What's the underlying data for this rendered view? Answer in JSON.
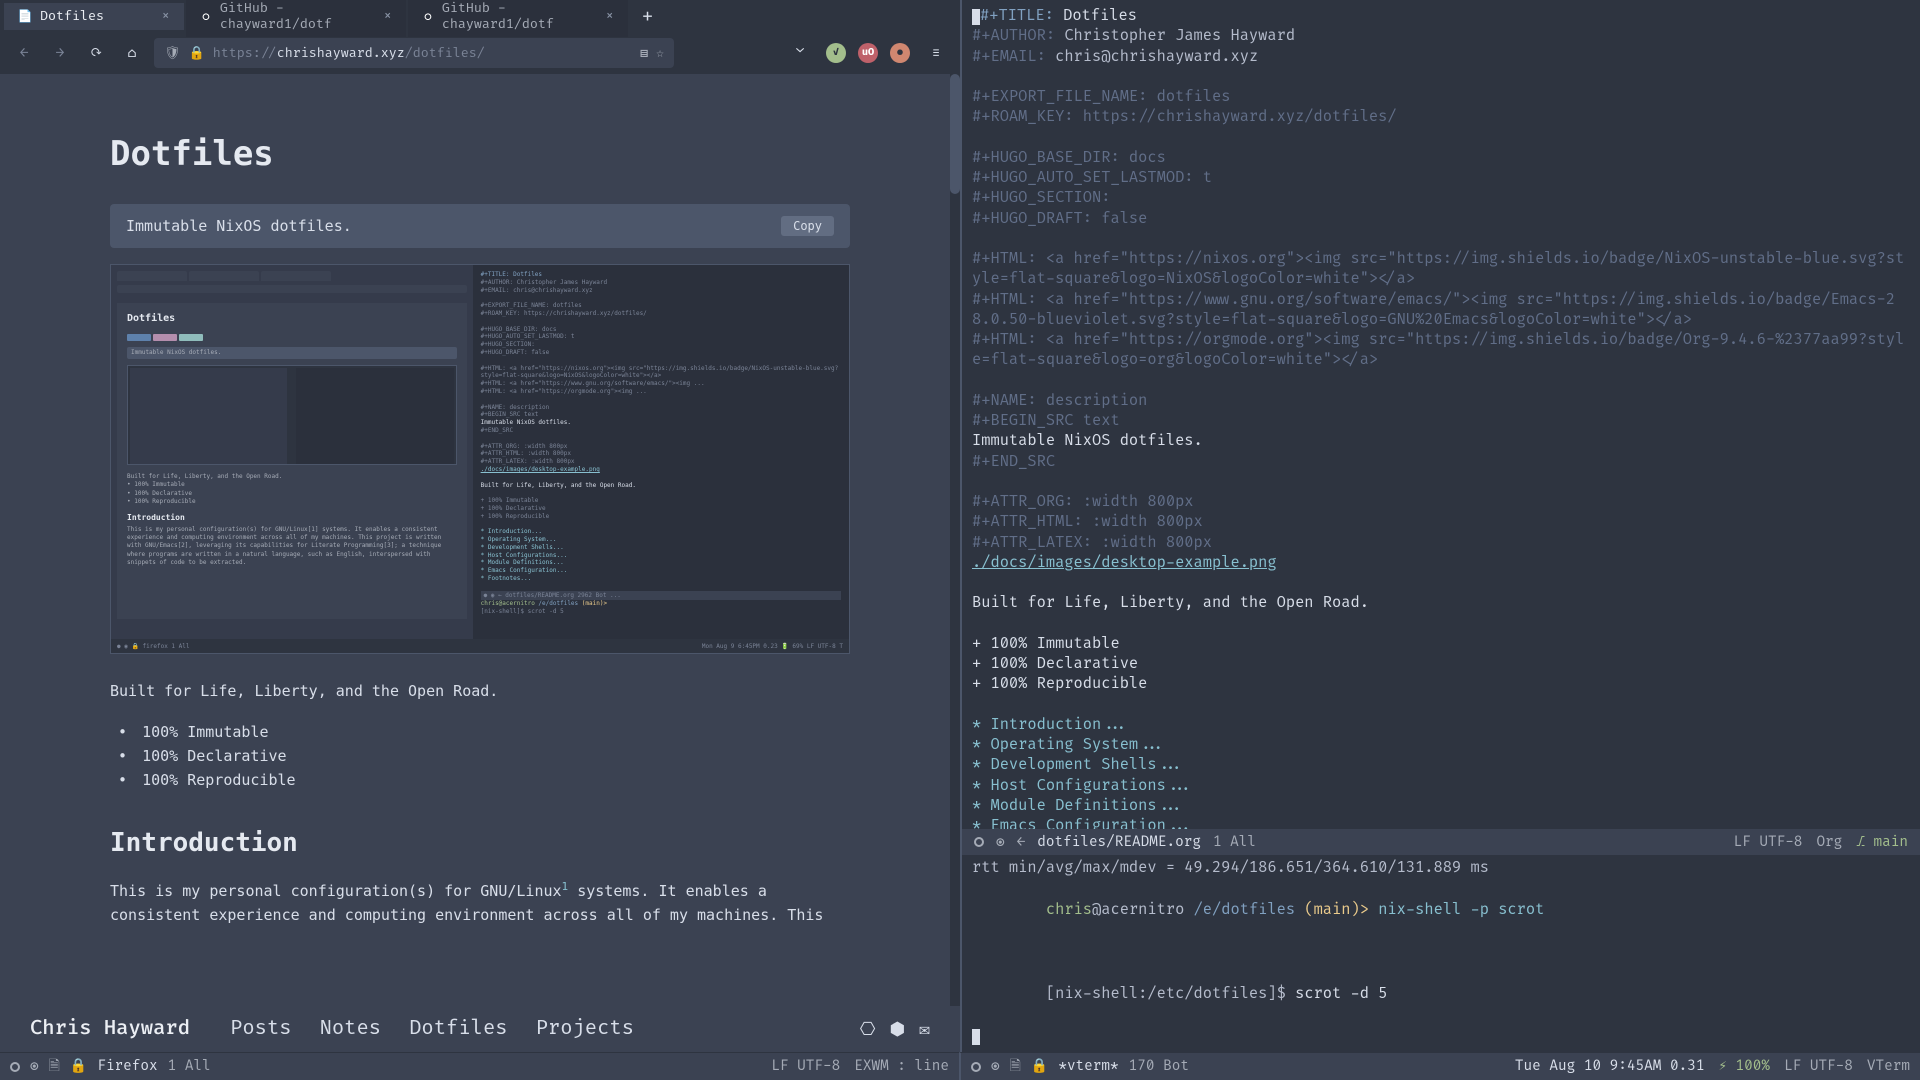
{
  "browser": {
    "tabs": [
      {
        "label": "Dotfiles",
        "icon": "📄"
      },
      {
        "label": "GitHub - chayward1/dotf",
        "icon": "◐"
      },
      {
        "label": "GitHub - chayward1/dotf",
        "icon": "◐"
      }
    ],
    "url_protocol": "https://",
    "url_domain": "chrishayward.xyz",
    "url_path": "/dotfiles/"
  },
  "page": {
    "title": "Dotfiles",
    "code_snippet": "Immutable NixOS dotfiles.",
    "copy_label": "Copy",
    "tagline": "Built for Life, Liberty, and the Open Road.",
    "features": [
      "100% Immutable",
      "100% Declarative",
      "100% Reproducible"
    ],
    "section_h": "Introduction",
    "body_1": "This is my personal configuration(s) for GNU/Linux",
    "body_2": " systems. It enables a consistent experience and computing environment across all of my machines. This",
    "footnote": "1"
  },
  "site_nav": {
    "brand": "Chris Hayward",
    "links": [
      "Posts",
      "Notes",
      "Dotfiles",
      "Projects"
    ]
  },
  "modeline_left": {
    "buffer": "Firefox",
    "pos": "1 All",
    "lf": "LF UTF-8",
    "mode": "EXWM : line"
  },
  "modeline_right": {
    "buffer": "*vterm*",
    "pos": "170 Bot",
    "time": "Tue Aug 10 9:45AM 0.31",
    "battery": "100%",
    "lf": "LF UTF-8",
    "mode": "VTerm"
  },
  "editor_modeline": {
    "buffer": "dotfiles/README.org",
    "pos": "1 All",
    "lf": "LF UTF-8",
    "mode": "Org",
    "branch": "main"
  },
  "org": {
    "title_kw": "#+TITLE:",
    "title": "Dotfiles",
    "author_kw": "#+AUTHOR:",
    "author": "Christopher James Hayward",
    "email_kw": "#+EMAIL:",
    "email": "chris@chrishayward.xyz",
    "export_file": "#+EXPORT_FILE_NAME: dotfiles",
    "roam_key": "#+ROAM_KEY: https://chrishayward.xyz/dotfiles/",
    "hugo_base": "#+HUGO_BASE_DIR: docs",
    "hugo_auto": "#+HUGO_AUTO_SET_LASTMOD: t",
    "hugo_section": "#+HUGO_SECTION:",
    "hugo_draft": "#+HUGO_DRAFT: false",
    "html1": "#+HTML: <a href=\"https://nixos.org\"><img src=\"https://img.shields.io/badge/NixOS-unstable-blue.svg?style=flat-square&logo=NixOS&logoColor=white\"></a>",
    "html2": "#+HTML: <a href=\"https://www.gnu.org/software/emacs/\"><img src=\"https://img.shields.io/badge/Emacs-28.0.50-blueviolet.svg?style=flat-square&logo=GNU%20Emacs&logoColor=white\"></a>",
    "html3": "#+HTML: <a href=\"https://orgmode.org\"><img src=\"https://img.shields.io/badge/Org-9.4.6-%2377aa99?style=flat-square&logo=org&logoColor=white\"></a>",
    "name": "#+NAME: description",
    "begin_src": "#+BEGIN_SRC text",
    "src_body": "Immutable NixOS dotfiles.",
    "end_src": "#+END_SRC",
    "attr_org": "#+ATTR_ORG: :width 800px",
    "attr_html": "#+ATTR_HTML: :width 800px",
    "attr_latex": "#+ATTR_LATEX: :width 800px",
    "img_link": "./docs/images/desktop-example.png",
    "tagline": "Built for Life, Liberty, and the Open Road.",
    "bullet1": "+ 100% Immutable",
    "bullet2": "+ 100% Declarative",
    "bullet3": "+ 100% Reproducible",
    "h_intro": "* Introduction...",
    "h_os": "* Operating System...",
    "h_dev": "* Development Shells...",
    "h_host": "* Host Configurations...",
    "h_module": "* Module Definitions...",
    "h_emacs": "* Emacs Configuration..."
  },
  "term": {
    "ping": "rtt min/avg/max/mdev = 49.294/186.651/364.610/131.889 ms",
    "user": "chris",
    "host": "@acernitro",
    "path": "/e/dotfiles",
    "branch": "(main)>",
    "cmd1": "nix-shell -p scrot",
    "prompt2": "[nix-shell:/etc/dotfiles]$",
    "cmd2": "scrot -d 5"
  },
  "mini": {
    "h1": "Dotfiles",
    "code": "Immutable NixOS dotfiles.",
    "tagline": "Built for Life, Liberty, and the Open Road.",
    "b1": "• 100% Immutable",
    "b2": "• 100% Declarative",
    "b3": "• 100% Reproducible",
    "h2": "Introduction",
    "para": "This is my personal configuration(s) for GNU/Linux[1] systems. It enables a consistent experience and computing environment across all of my machines. This project is written with GNU/Emacs[2], leveraging its capabilities for Literate Programming[3]; a technique where programs are written in a natural language, such as English, interspersed with snippets of code to be extracted.",
    "r_title": "#+TITLE: Dotfiles",
    "r_author": "#+AUTHOR: Christopher James Hayward",
    "r_email": "#+EMAIL: chris@chrishayward.xyz",
    "r_src": "Immutable NixOS dotfiles.",
    "r_tag": "Built for Life, Liberty, and the Open Road.",
    "bar_left": "● ◉ 🔒 firefox  1 All",
    "bar_right": "Mon Aug  9 6:45PM 0.23  🔋 69%  LF UTF-8  T"
  }
}
